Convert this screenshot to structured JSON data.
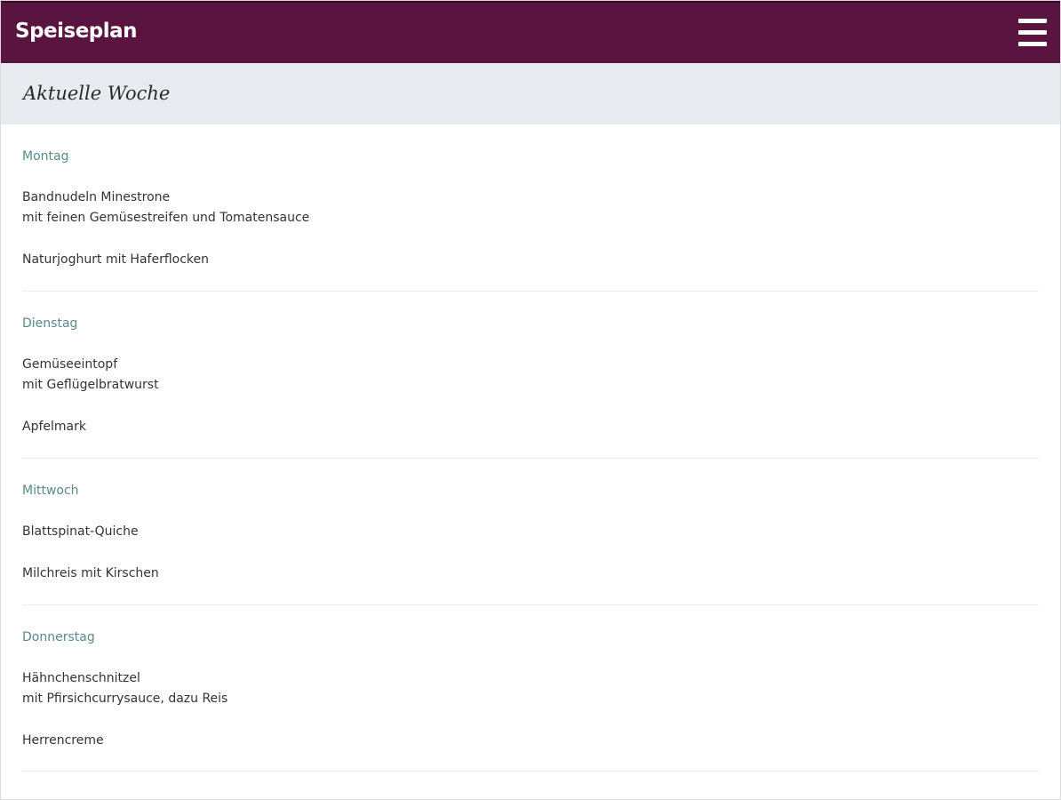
{
  "header": {
    "title": "Speiseplan",
    "menu_icon": "hamburger-menu-icon",
    "background_color": "#5a1440"
  },
  "week": {
    "title": "Aktuelle Woche"
  },
  "days": [
    {
      "name": "Montag",
      "main_line1": "Bandnudeln Minestrone",
      "main_line2": "mit feinen Gemüsestreifen und Tomatensauce",
      "dessert": "Naturjoghurt mit Haferflocken"
    },
    {
      "name": "Dienstag",
      "main_line1": "Gemüseeintopf",
      "main_line2": "mit Geflügelbratwurst",
      "dessert": "Apfelmark"
    },
    {
      "name": "Mittwoch",
      "main_line1": "Blattspinat-Quiche",
      "dessert": "Milchreis mit Kirschen"
    },
    {
      "name": "Donnerstag",
      "main_line1": "Hähnchenschnitzel",
      "main_line2": "mit Pfirsichcurrysauce, dazu Reis",
      "dessert": "Herrencreme"
    }
  ]
}
